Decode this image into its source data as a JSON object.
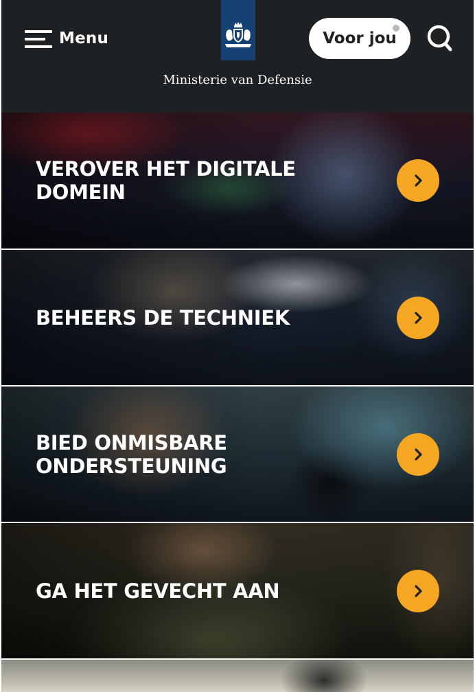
{
  "header": {
    "menu_label": "Menu",
    "ministry_name": "Ministerie van Defensie",
    "voor_jou_label": "Voor jou",
    "icons": {
      "menu": "hamburger-icon",
      "emblem": "coat-of-arms-icon",
      "search": "search-icon",
      "notification": "notification-dot-icon"
    },
    "colors": {
      "background": "#1e2124",
      "emblem": "#154273",
      "text": "#ffffff"
    }
  },
  "tiles": [
    {
      "title": "VEROVER HET DIGITALE DOMEIN"
    },
    {
      "title": "BEHEERS DE TECHNIEK"
    },
    {
      "title": "BIED ONMISBARE ONDERSTEUNING"
    },
    {
      "title": "GA HET GEVECHT AAN"
    },
    {
      "title": ""
    }
  ],
  "tile_icon": "chevron-right-icon",
  "colors": {
    "accent": "#f5a623"
  }
}
